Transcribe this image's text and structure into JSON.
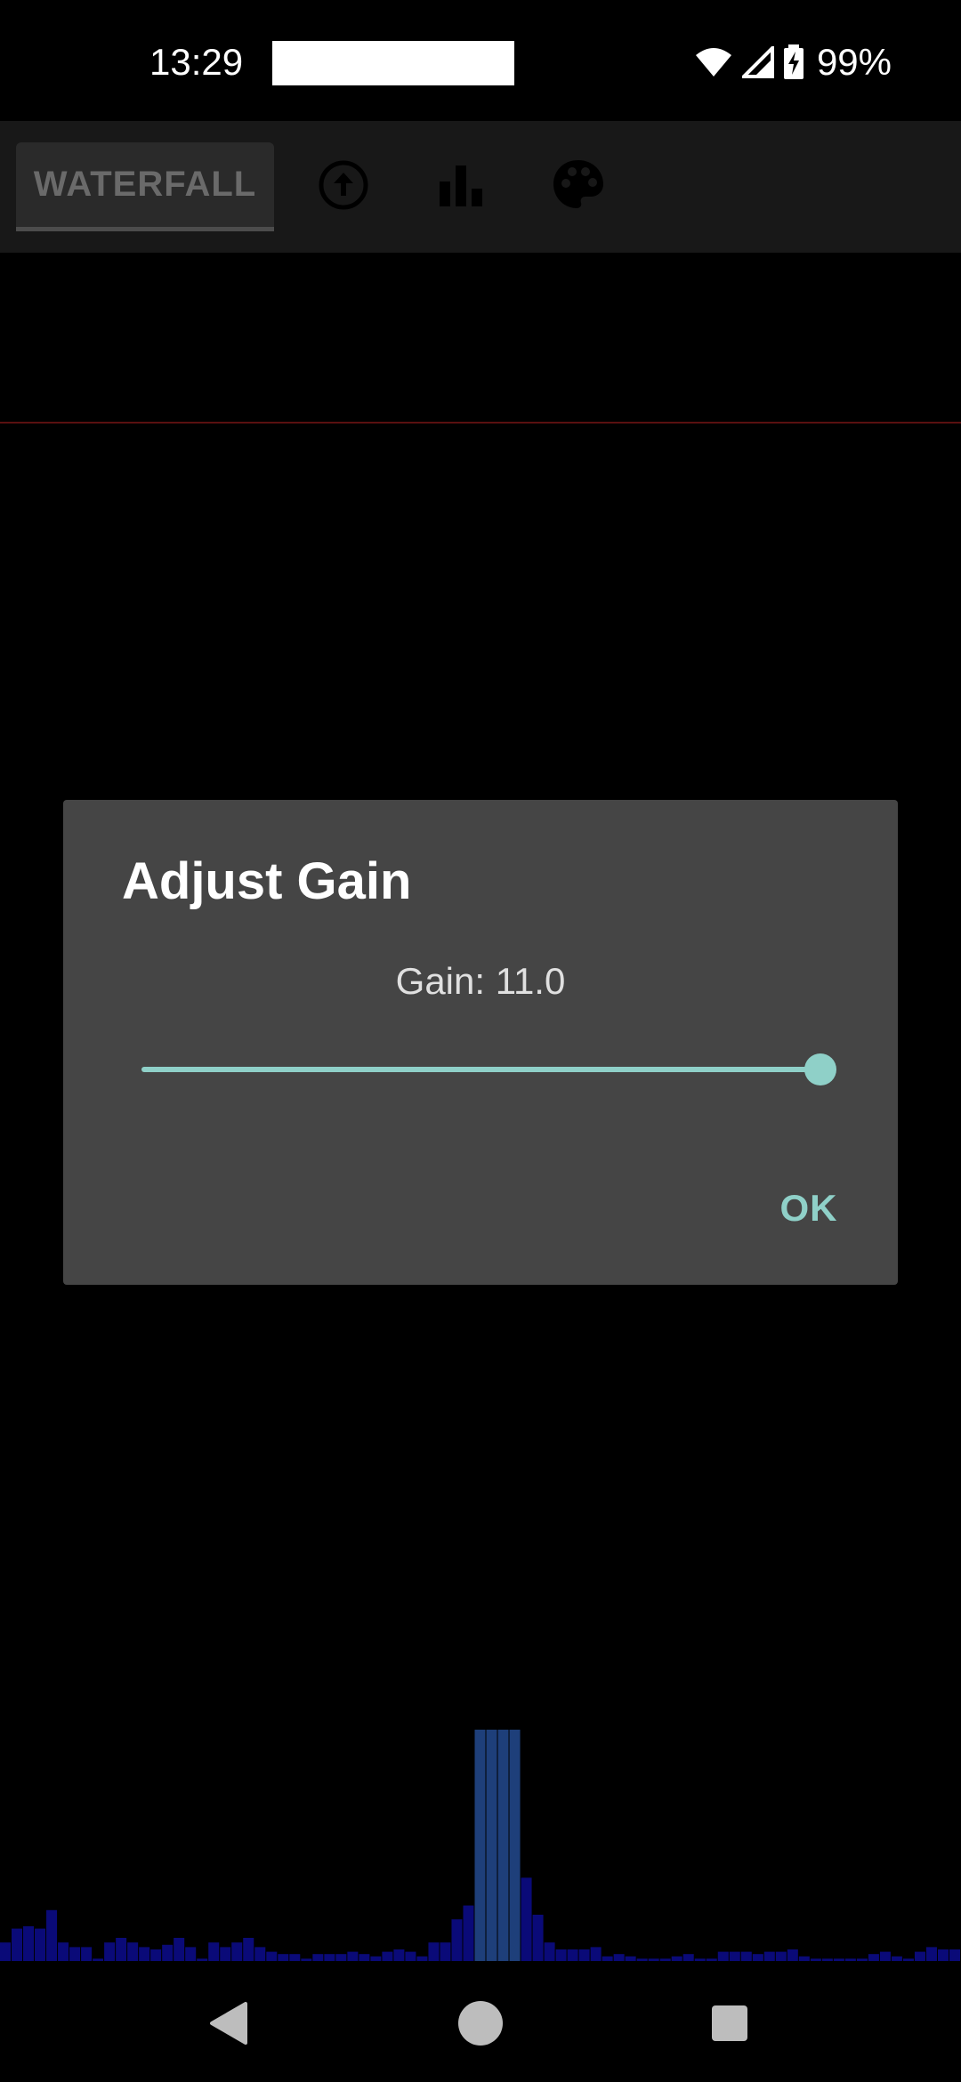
{
  "status_bar": {
    "time": "13:29",
    "battery": "99%",
    "icons": [
      "wifi-icon",
      "cell-signal-icon",
      "battery-charging-icon"
    ]
  },
  "toolbar": {
    "tab_label": "WATERFALL",
    "icons": [
      "upload-icon",
      "bar-chart-icon",
      "palette-icon"
    ]
  },
  "dialog": {
    "title": "Adjust Gain",
    "gain_text": "Gain: 11.0",
    "slider_fraction": 1.0,
    "ok_label": "OK",
    "accent_color": "#8fd0c8"
  },
  "spectrum": {
    "color": "#0a0a78",
    "peak_color": "#1e3f7a",
    "levels": [
      0.08,
      0.14,
      0.15,
      0.14,
      0.22,
      0.08,
      0.06,
      0.06,
      0.01,
      0.08,
      0.1,
      0.08,
      0.06,
      0.05,
      0.07,
      0.1,
      0.06,
      0.01,
      0.08,
      0.06,
      0.08,
      0.1,
      0.06,
      0.04,
      0.03,
      0.03,
      0.01,
      0.03,
      0.03,
      0.03,
      0.04,
      0.03,
      0.02,
      0.04,
      0.05,
      0.04,
      0.02,
      0.08,
      0.08,
      0.18,
      0.24,
      1.0,
      1.0,
      1.0,
      1.0,
      0.36,
      0.2,
      0.08,
      0.05,
      0.05,
      0.05,
      0.06,
      0.02,
      0.03,
      0.02,
      0.01,
      0.01,
      0.01,
      0.02,
      0.03,
      0.01,
      0.01,
      0.04,
      0.04,
      0.04,
      0.03,
      0.04,
      0.04,
      0.05,
      0.02,
      0.01,
      0.01,
      0.01,
      0.01,
      0.01,
      0.03,
      0.04,
      0.02,
      0.01,
      0.04,
      0.06,
      0.05,
      0.05
    ]
  },
  "nav": {
    "icons": [
      "back-icon",
      "home-icon",
      "recents-icon"
    ]
  }
}
